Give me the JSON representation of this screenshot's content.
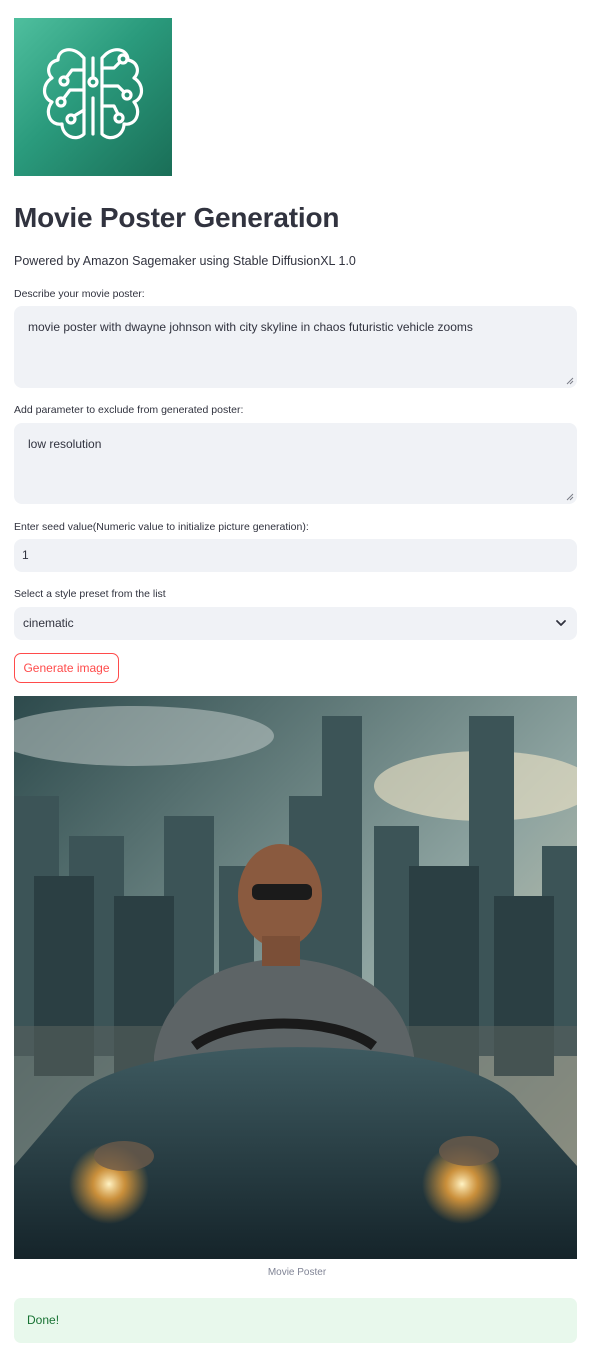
{
  "header": {
    "logo_icon": "sagemaker-brain-circuit-icon",
    "title": "Movie Poster Generation",
    "subtitle": "Powered by Amazon Sagemaker using Stable DiffusionXL 1.0"
  },
  "form": {
    "prompt": {
      "label": "Describe your movie poster:",
      "value": "movie poster with dwayne johnson with city skyline in chaos futuristic vehicle zooms"
    },
    "negative": {
      "label": "Add parameter to exclude from generated poster:",
      "value": "low resolution"
    },
    "seed": {
      "label": "Enter seed value(Numeric value to initialize picture generation):",
      "value": "1"
    },
    "style": {
      "label": "Select a style preset from the list",
      "selected": "cinematic"
    },
    "generate_label": "Generate image"
  },
  "result": {
    "caption": "Movie Poster",
    "status": "Done!"
  },
  "colors": {
    "accent": "#ff4b4b",
    "input_bg": "#f0f2f6",
    "success_bg": "#e8f8ec",
    "success_text": "#177233",
    "logo_gradient": [
      "#4fbf9e",
      "#1a6e57"
    ]
  }
}
